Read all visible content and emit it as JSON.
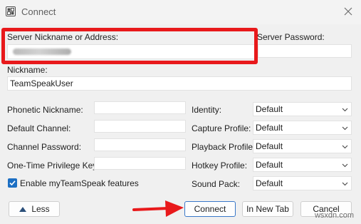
{
  "window": {
    "title": "Connect",
    "close_icon": "close-icon",
    "app_icon": "teamspeak-icon"
  },
  "server": {
    "address_label": "Server Nickname or Address:",
    "address_value": "",
    "password_label": "Server Password:",
    "password_value": ""
  },
  "nickname": {
    "label": "Nickname:",
    "value": "TeamSpeakUser"
  },
  "left_fields": [
    {
      "label": "Phonetic Nickname:",
      "value": ""
    },
    {
      "label": "Default Channel:",
      "value": ""
    },
    {
      "label": "Channel Password:",
      "value": ""
    },
    {
      "label": "One-Time Privilege Key:",
      "value": ""
    }
  ],
  "right_fields": [
    {
      "label": "Identity:",
      "value": "Default"
    },
    {
      "label": "Capture Profile:",
      "value": "Default"
    },
    {
      "label": "Playback Profile:",
      "value": "Default"
    },
    {
      "label": "Hotkey Profile:",
      "value": "Default"
    },
    {
      "label": "Sound Pack:",
      "value": "Default"
    }
  ],
  "checkbox": {
    "label": "Enable myTeamSpeak features",
    "checked": true
  },
  "buttons": {
    "less": "Less",
    "connect": "Connect",
    "new_tab": "In New Tab",
    "cancel": "Cancel"
  },
  "watermark": "wsxdn.com",
  "colors": {
    "highlight": "#e8191b",
    "accent": "#1c6fc3"
  }
}
